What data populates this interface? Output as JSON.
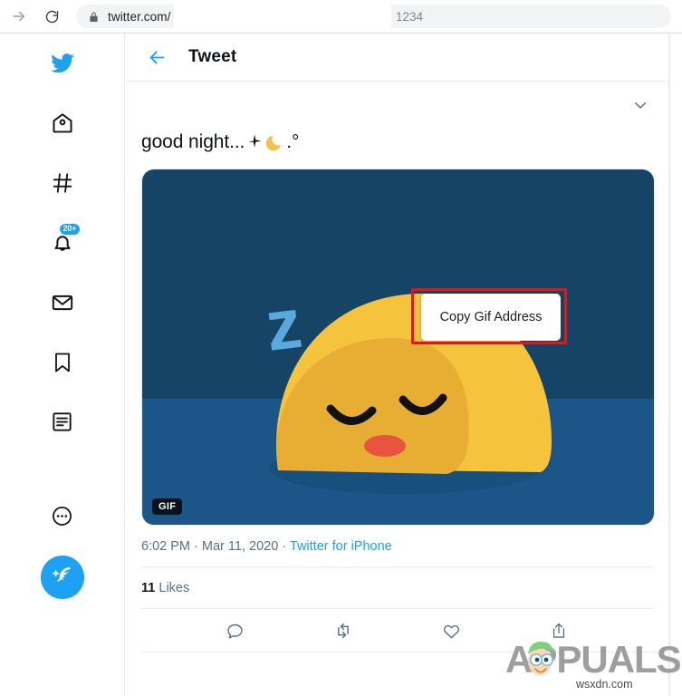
{
  "browser": {
    "forward_icon": "forward-arrow-icon",
    "reload_icon": "reload-icon",
    "lock_icon": "lock-icon",
    "url": "twitter.com/",
    "url_tail": "1234"
  },
  "sidebar": {
    "items": [
      {
        "id": "logo",
        "icon": "twitter-bird-icon",
        "label": "Twitter"
      },
      {
        "id": "home",
        "icon": "home-icon",
        "label": "Home"
      },
      {
        "id": "explore",
        "icon": "hashtag-icon",
        "label": "Explore"
      },
      {
        "id": "notifications",
        "icon": "bell-icon",
        "label": "Notifications",
        "badge": "20+"
      },
      {
        "id": "messages",
        "icon": "envelope-icon",
        "label": "Messages"
      },
      {
        "id": "bookmarks",
        "icon": "bookmark-icon",
        "label": "Bookmarks"
      },
      {
        "id": "lists",
        "icon": "lists-icon",
        "label": "Lists"
      },
      {
        "id": "more",
        "icon": "more-dots-icon",
        "label": "More"
      }
    ],
    "compose": {
      "icon": "feather-compose-icon",
      "label": "Tweet"
    }
  },
  "header": {
    "back_icon": "back-arrow-icon",
    "title": "Tweet"
  },
  "tweet": {
    "caret_icon": "chevron-down-icon",
    "text_prefix": "good night...",
    "emoji_sparkle": "sparkle-emoji",
    "emoji_moon": "crescent-moon-emoji",
    "text_suffix": ".°",
    "media": {
      "type": "gif",
      "badge": "GIF",
      "alt": "sleeping yellow blob emoji with Z letters",
      "bg_dark": "#164466",
      "bg_floor": "#1c5689",
      "blob_color": "#f5c033",
      "blob_shadow": "#e0a82a",
      "z_color": "#5aa9dd",
      "mouth_color": "#e8543f"
    },
    "context_menu": {
      "item": "Copy Gif Address"
    },
    "annotation": {
      "color": "#e81313"
    },
    "meta": {
      "time": "6:02 PM",
      "sep1": " · ",
      "date": "Mar 11, 2020",
      "sep2": " · ",
      "source": "Twitter for iPhone"
    },
    "likes": {
      "count": "11",
      "label": "Likes"
    },
    "actions": [
      {
        "id": "reply",
        "icon": "reply-icon",
        "label": "Reply"
      },
      {
        "id": "retweet",
        "icon": "retweet-icon",
        "label": "Retweet"
      },
      {
        "id": "like",
        "icon": "heart-icon",
        "label": "Like"
      },
      {
        "id": "share",
        "icon": "share-icon",
        "label": "Share"
      }
    ]
  },
  "watermark": {
    "brand": "APPUALS",
    "site": "wsxdn.com"
  },
  "colors": {
    "twitter_blue": "#1da1f2",
    "text_primary": "#0f1419",
    "text_secondary": "#5b7083",
    "annotation_red": "#e81313"
  }
}
